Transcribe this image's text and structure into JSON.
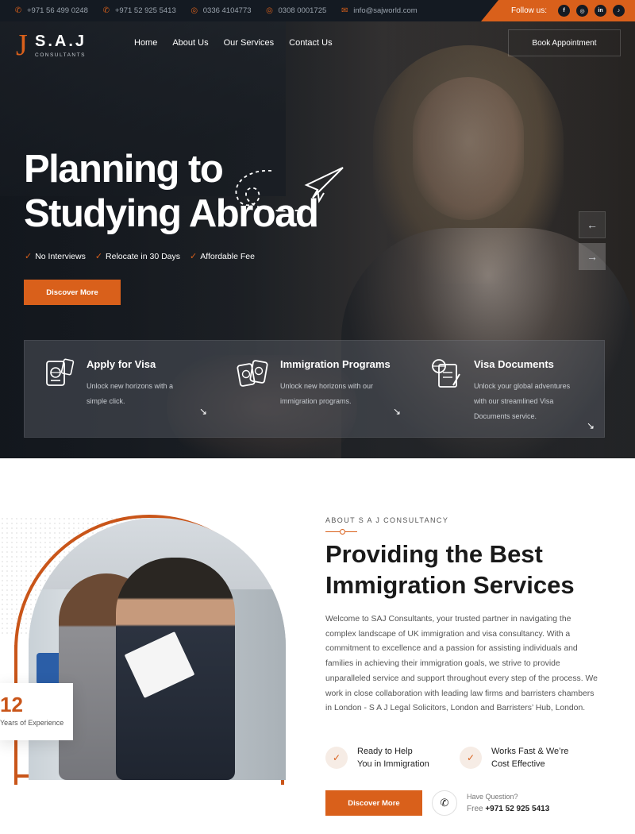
{
  "topbar": {
    "contacts": [
      {
        "icon": "phone-icon",
        "glyph": "✆",
        "text": "+971 56 499 0248"
      },
      {
        "icon": "phone-icon",
        "glyph": "✆",
        "text": "+971 52 925 5413"
      },
      {
        "icon": "whatsapp-icon",
        "glyph": "◎",
        "text": "0336 4104773"
      },
      {
        "icon": "whatsapp-icon",
        "glyph": "◎",
        "text": "0308 0001725"
      },
      {
        "icon": "mail-icon",
        "glyph": "✉",
        "text": "info@sajworld.com"
      }
    ],
    "follow_label": "Follow us:",
    "socials": [
      {
        "icon": "facebook-icon",
        "glyph": "f"
      },
      {
        "icon": "instagram-icon",
        "glyph": "◎"
      },
      {
        "icon": "linkedin-icon",
        "glyph": "in"
      },
      {
        "icon": "tiktok-icon",
        "glyph": "♪"
      }
    ]
  },
  "header": {
    "logo_mark": "J",
    "logo_title": "S.A.J",
    "logo_sub": "CONSULTANTS",
    "nav": [
      "Home",
      "About Us",
      "Our Services",
      "Contact Us"
    ],
    "book_label": "Book Appointment"
  },
  "hero": {
    "title_lines": [
      "Planning to",
      "Studying Abroad"
    ],
    "ticks": [
      "No Interviews",
      "Relocate in 30 Days",
      "Affordable Fee"
    ],
    "cta": "Discover More",
    "prev_glyph": "←",
    "next_glyph": "→",
    "cards": [
      {
        "icon": "passport-icon",
        "title": "Apply for Visa",
        "desc": "Unlock new horizons with a simple click.",
        "arrow": "↘"
      },
      {
        "icon": "passports-icon",
        "title": "Immigration Programs",
        "desc": "Unlock new horizons with our immigration programs.",
        "arrow": "↘"
      },
      {
        "icon": "visa-documents-icon",
        "title": "Visa Documents",
        "desc": "Unlock your global adventures with our streamlined Visa Documents service.",
        "arrow": "↘"
      }
    ]
  },
  "about": {
    "eyebrow": "ABOUT S A J CONSULTANCY",
    "title_lines": [
      "Providing the Best",
      "Immigration Services"
    ],
    "body": "Welcome to SAJ Consultants, your trusted partner in navigating the complex landscape of UK immigration and visa consultancy. With a commitment to excellence and a passion for assisting individuals and families in achieving their immigration goals, we strive to provide unparalleled service and support throughout every step of the process. We work in close collaboration with leading law firms and barristers chambers in London - S A J Legal Solicitors, London and Barristers’ Hub, London.",
    "experience_number": "12",
    "experience_label": "Years of Experience",
    "features": [
      {
        "lines": [
          "Ready to Help",
          "You in Immigration"
        ]
      },
      {
        "lines": [
          "Works Fast & We’re",
          "Cost Effective"
        ]
      }
    ],
    "cta": "Discover More",
    "question_label": "Have Question?",
    "free_label": "Free",
    "phone": "+971 52 925 5413"
  },
  "colors": {
    "accent": "#d9601b",
    "dark": "#141a22"
  }
}
